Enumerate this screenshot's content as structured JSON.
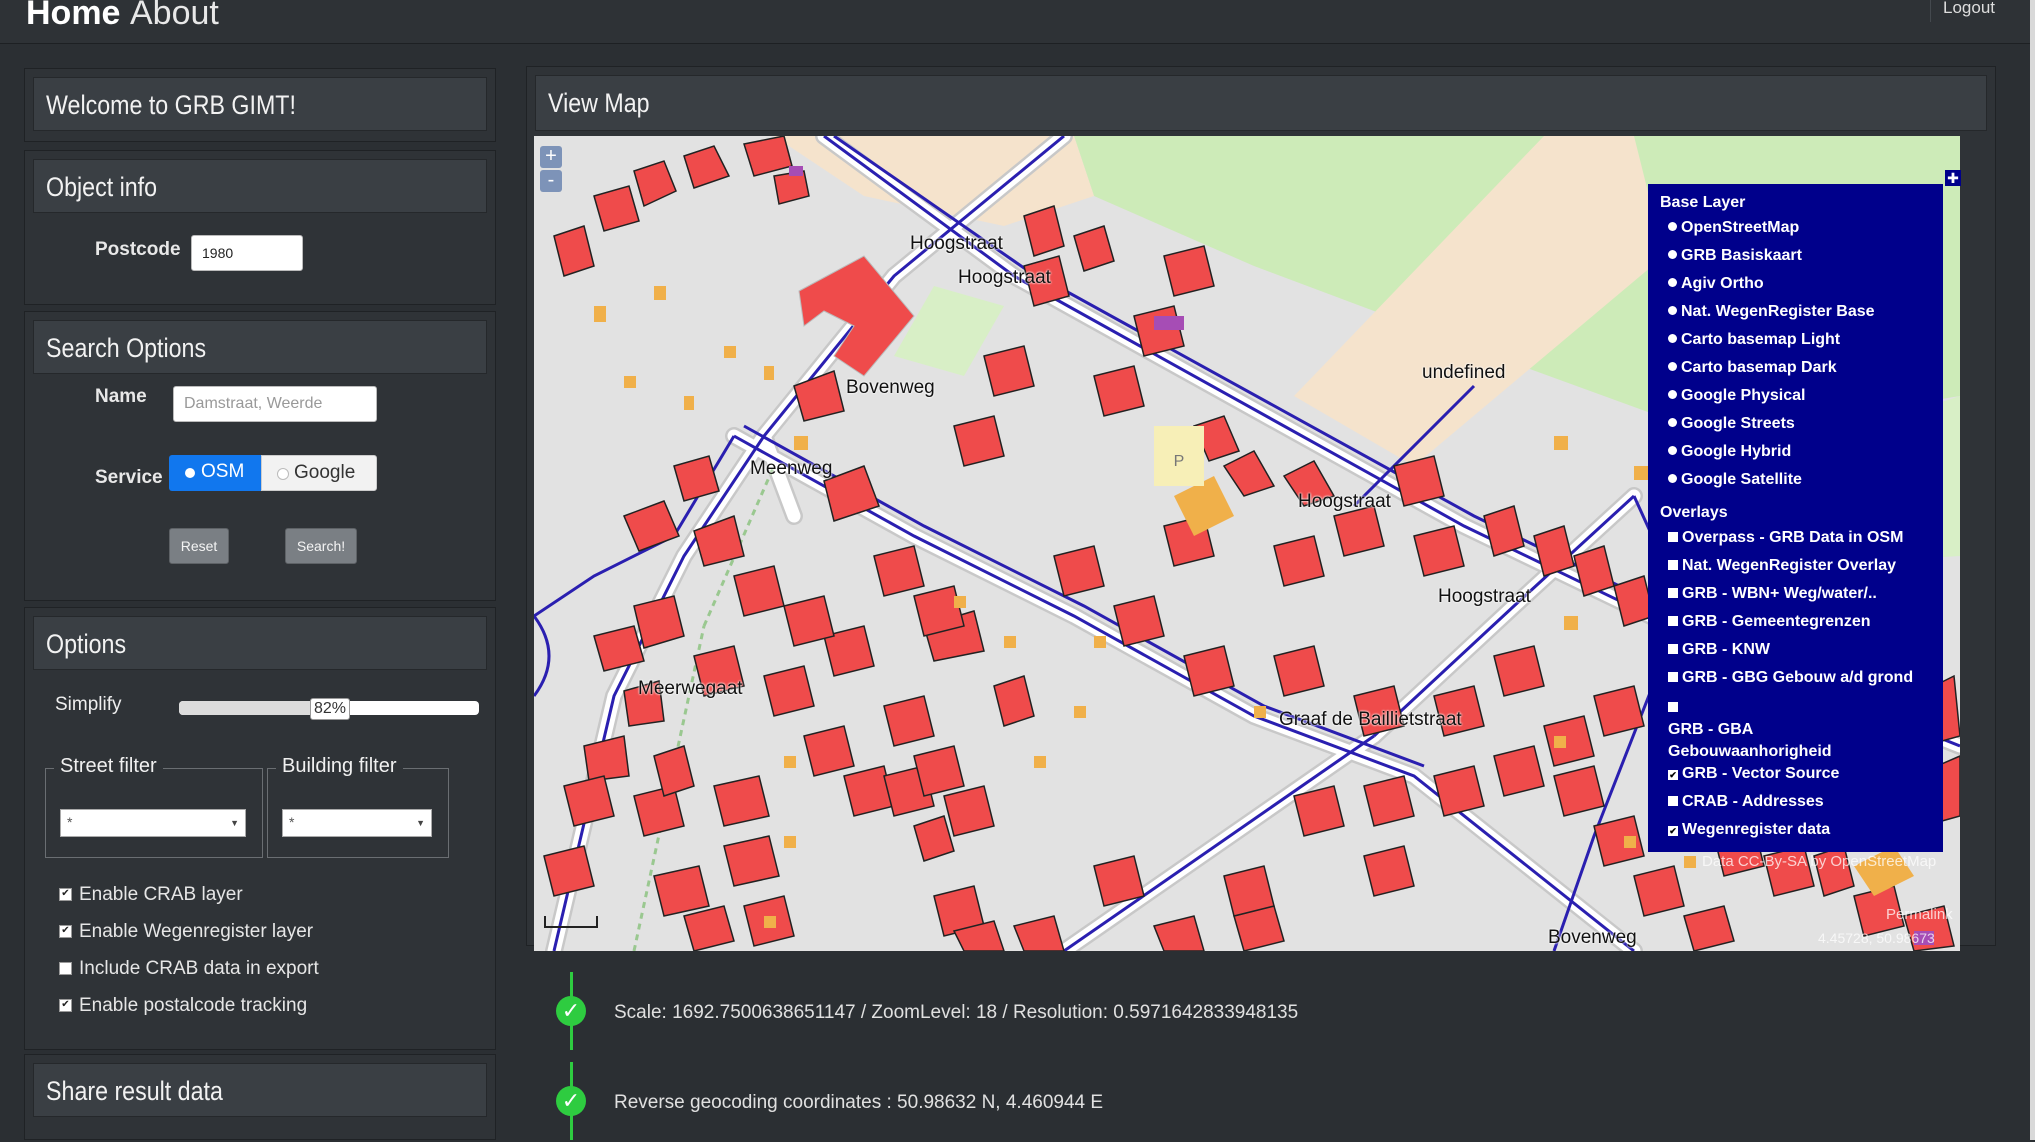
{
  "nav": {
    "brand": "Home",
    "about": "About",
    "logout": "Logout"
  },
  "panels": {
    "welcome": {
      "title": "Welcome to GRB GIMT!"
    },
    "object_info": {
      "title": "Object info",
      "postcode_label": "Postcode",
      "postcode_value": "1980"
    },
    "search": {
      "title": "Search Options",
      "name_label": "Name",
      "name_placeholder": "Damstraat, Weerde",
      "service_label": "Service",
      "service_osm": "OSM",
      "service_google": "Google",
      "service_selected": "OSM",
      "reset_label": "Reset",
      "search_label": "Search!"
    },
    "options": {
      "title": "Options",
      "simplify_label": "Simplify",
      "simplify_value": "82%",
      "simplify_fraction": 0.5,
      "street_filter_label": "Street filter",
      "building_filter_label": "Building filter",
      "street_filter_value": "*",
      "building_filter_value": "*",
      "checkboxes": [
        {
          "label": "Enable CRAB layer",
          "checked": true
        },
        {
          "label": "Enable Wegenregister layer",
          "checked": true
        },
        {
          "label": "Include CRAB data in export",
          "checked": false
        },
        {
          "label": "Enable postalcode tracking",
          "checked": true
        }
      ]
    },
    "share": {
      "title": "Share result data"
    }
  },
  "map": {
    "title": "View Map",
    "zoom_in": "+",
    "zoom_out": "-",
    "labels": {
      "hoogstraat_1": "Hoogstraat",
      "hoogstraat_2": "Hoogstraat",
      "bovenweg_1": "Bovenweg",
      "meenweg": "Meenweg",
      "undefined": "undefined",
      "hoogstraat_3": "Hoogstraat",
      "hoogstraat_4": "Hoogstraat",
      "meerwegaat": "Meerwegaat",
      "graaf": "Graaf de Baillietstraat",
      "bovenweg_2": "Bovenweg"
    },
    "layer_switcher": {
      "base_header": "Base Layer",
      "base_layers": [
        {
          "label": "OpenStreetMap",
          "selected": true
        },
        {
          "label": "GRB Basiskaart",
          "selected": false
        },
        {
          "label": "Agiv Ortho",
          "selected": false
        },
        {
          "label": "Nat. WegenRegister Base",
          "selected": false
        },
        {
          "label": "Carto basemap Light",
          "selected": false
        },
        {
          "label": "Carto basemap Dark",
          "selected": false
        },
        {
          "label": "Google Physical",
          "selected": false
        },
        {
          "label": "Google Streets",
          "selected": false
        },
        {
          "label": "Google Hybrid",
          "selected": false
        },
        {
          "label": "Google Satellite",
          "selected": false
        }
      ],
      "overlay_header": "Overlays",
      "overlays": [
        {
          "label": "Overpass - GRB Data in OSM",
          "checked": false
        },
        {
          "label": "Nat. WegenRegister Overlay",
          "checked": false
        },
        {
          "label": "GRB - WBN+ Weg/water/..",
          "checked": false
        },
        {
          "label": "GRB - Gemeentegrenzen",
          "checked": false
        },
        {
          "label": "GRB - KNW",
          "checked": false
        },
        {
          "label": "GRB - GBG Gebouw a/d grond",
          "checked": false
        },
        {
          "label": "GRB - GBA Gebouwaanhorigheid",
          "checked": false
        },
        {
          "label": "GRB - Vector Source",
          "checked": true
        },
        {
          "label": "CRAB - Addresses",
          "checked": false
        },
        {
          "label": "Wegenregister data",
          "checked": true
        }
      ]
    },
    "attribution": "Data CC-By-SA by OpenStreetMap",
    "permalink": "Permalink",
    "coords": "4.45728, 50.98673"
  },
  "status": {
    "scale_text": "Scale: 1692.7500638651147 / ZoomLevel: 18 / Resolution: 0.5971642833948135",
    "geocode_text": "Reverse geocoding coordinates : 50.98632 N, 4.460944 E"
  }
}
